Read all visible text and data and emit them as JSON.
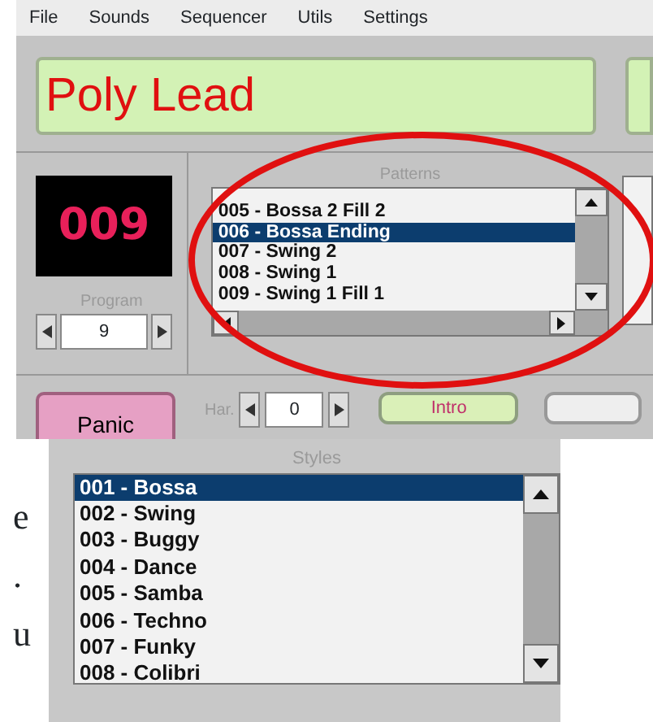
{
  "menu": [
    "File",
    "Sounds",
    "Sequencer",
    "Utils",
    "Settings"
  ],
  "sound_name": "Poly Lead",
  "program": {
    "display": "009",
    "label": "Program",
    "value": "9"
  },
  "patterns": {
    "label": "Patterns",
    "items": [
      {
        "text": "005 - Bossa 2 Fill 2",
        "selected": false
      },
      {
        "text": "006 - Bossa Ending",
        "selected": true
      },
      {
        "text": "007 - Swing 2",
        "selected": false
      },
      {
        "text": "008 - Swing 1",
        "selected": false
      },
      {
        "text": "009 - Swing 1 Fill 1",
        "selected": false
      }
    ]
  },
  "panic": "Panic",
  "harmony": {
    "label": "Har.",
    "value": "0"
  },
  "section_buttons": [
    "Intro"
  ],
  "document_fragments": [
    "e",
    ".",
    "u"
  ],
  "styles": {
    "label": "Styles",
    "items": [
      {
        "text": "001 - Bossa",
        "selected": true
      },
      {
        "text": "002 - Swing",
        "selected": false
      },
      {
        "text": "003 - Buggy",
        "selected": false
      },
      {
        "text": "004 - Dance",
        "selected": false
      },
      {
        "text": "005 - Samba",
        "selected": false
      },
      {
        "text": "006 - Techno",
        "selected": false
      },
      {
        "text": "007 - Funky",
        "selected": false
      },
      {
        "text": "008 - Colibri",
        "selected": false
      }
    ]
  }
}
